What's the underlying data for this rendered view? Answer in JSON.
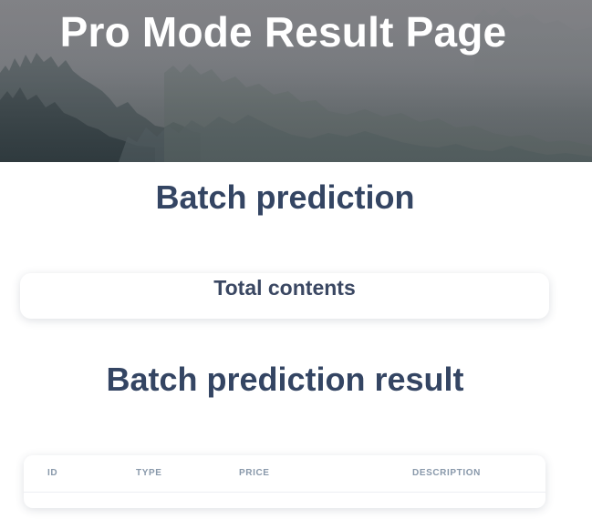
{
  "hero": {
    "title": "Pro Mode Result Page"
  },
  "batch": {
    "title": "Batch prediction"
  },
  "total_card": {
    "title": "Total contents"
  },
  "result": {
    "title": "Batch prediction result"
  },
  "table": {
    "columns": [
      "ID",
      "TYPE",
      "PRICE",
      "DESCRIPTION"
    ],
    "rows": []
  },
  "colors": {
    "heading": "#344563",
    "table_header": "#8898aa",
    "hero_overlay": "#76767a"
  }
}
